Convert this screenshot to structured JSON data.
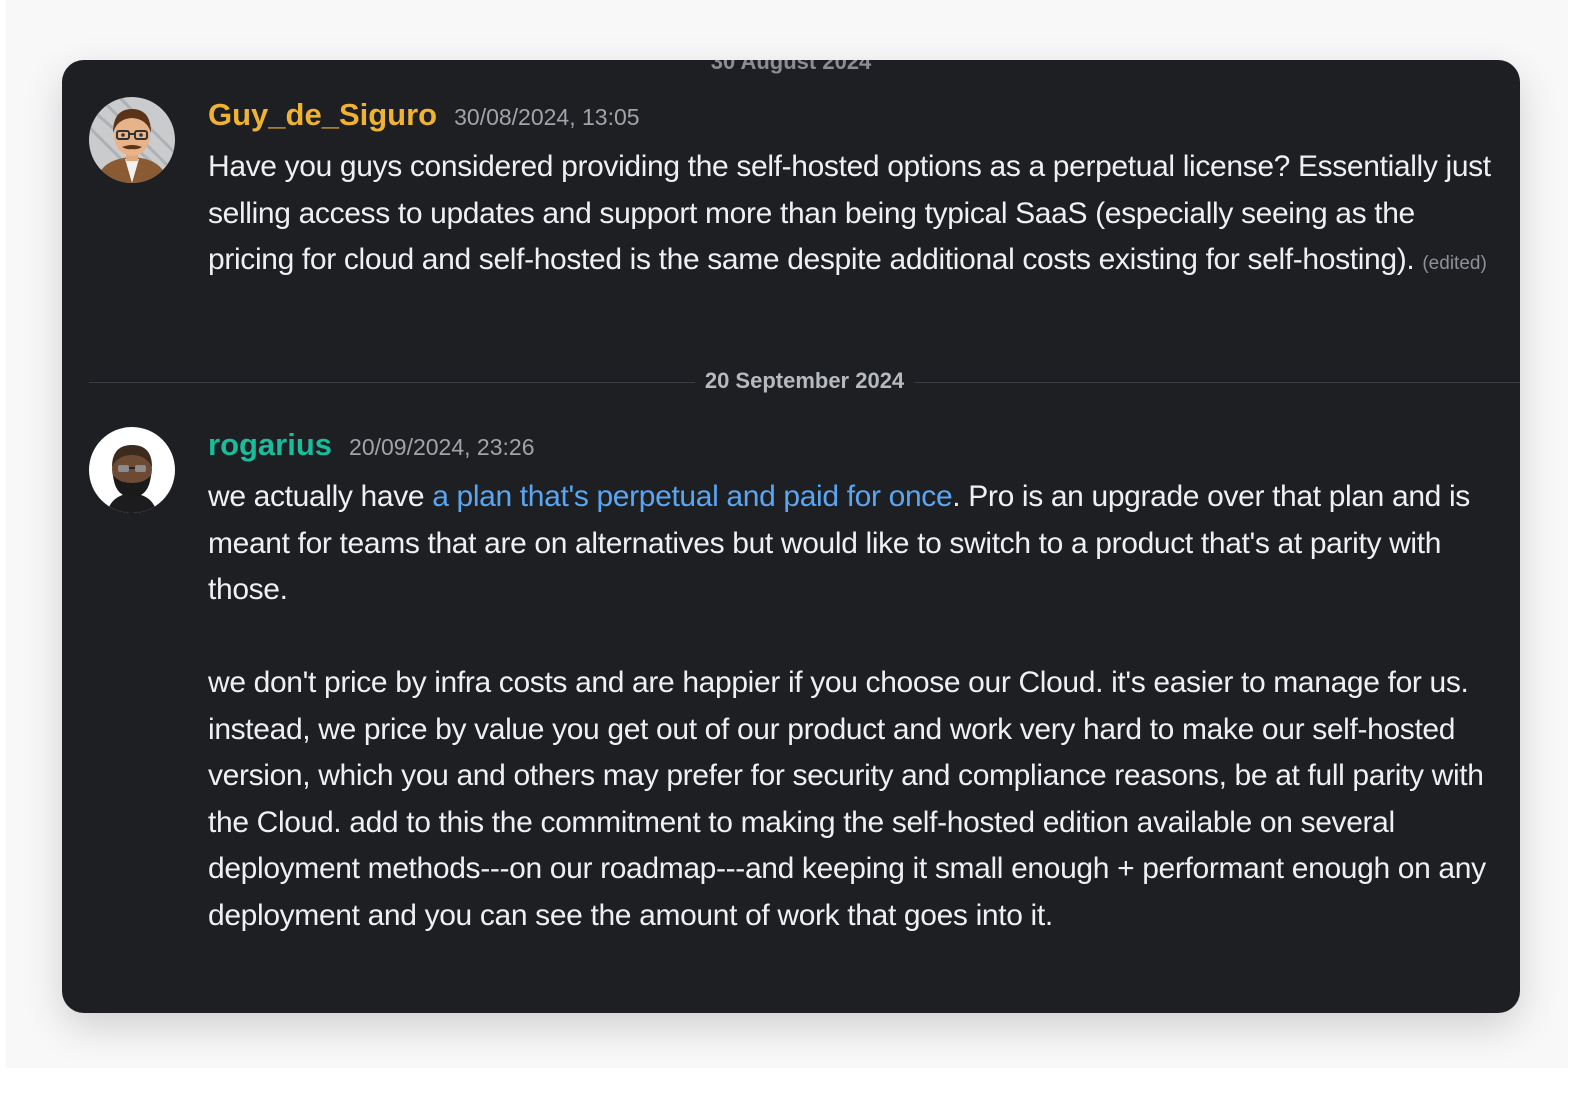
{
  "messages": [
    {
      "username": "Guy_de_Siguro",
      "username_color": "#f0b232",
      "timestamp": "30/08/2024, 13:05",
      "avatar": "cartoon-man-with-glasses-avatar",
      "text": "Have you guys considered providing the self-hosted options as a perpetual license? Essentially just selling access to updates and support more than being typical SaaS (especially seeing as the pricing for cloud and self-hosted is the same despite additional costs existing for self-hosting).",
      "edited_label": "(edited)"
    },
    {
      "username": "rogarius",
      "username_color": "#1abc9c",
      "timestamp": "20/09/2024, 23:26",
      "avatar": "bearded-man-avatar",
      "text_before_link": "we actually have ",
      "link_text": "a plan that's perpetual and paid for once",
      "text_after_link": ". Pro is an upgrade over that plan and is meant for teams that are on alternatives but would like to switch to a product that's at parity with those.",
      "paragraph2": "we don't price by infra costs and are happier if you choose our Cloud. it's easier to manage for us. instead, we price by value you get out of our product and work very hard to make our self-hosted version, which you and others may prefer for security and compliance reasons, be at full parity with the Cloud. add to this the commitment to making the self-hosted edition available on several deployment methods---on our roadmap---and keeping it small enough + performant enough on any deployment and you can see the amount of work that goes into it."
    }
  ],
  "date_divider": "20 September 2024",
  "colors": {
    "card_background": "#1e1f22",
    "text": "#eef0f2",
    "link": "#5aa6f2",
    "timestamp": "#a0a3a8"
  }
}
